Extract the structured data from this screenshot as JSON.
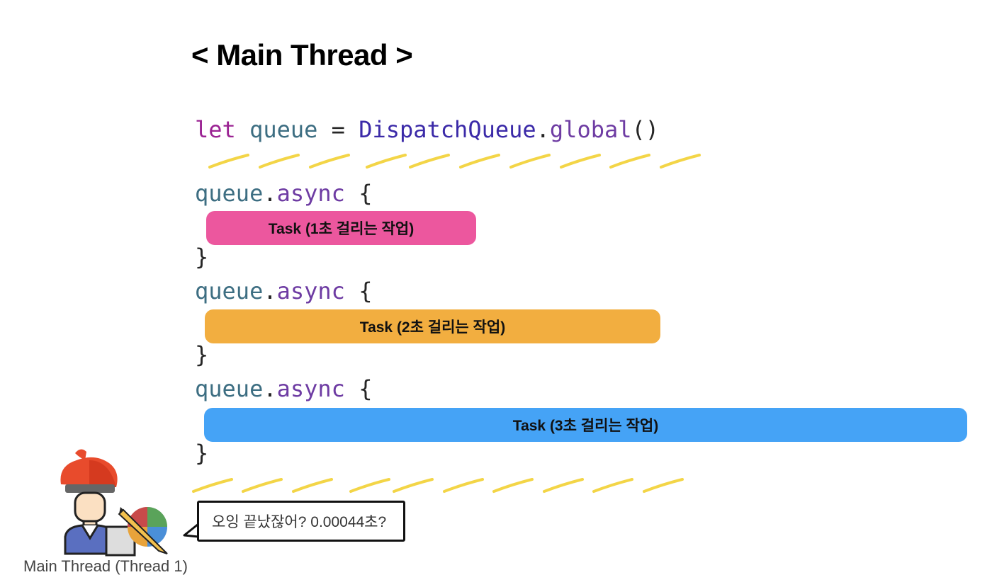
{
  "title": "< Main Thread >",
  "code": {
    "line1": {
      "kw": "let",
      "var": "queue",
      "eq": "=",
      "type": "DispatchQueue",
      "dot": ".",
      "method": "global",
      "paren": "()"
    },
    "async_block": {
      "var": "queue",
      "dot": ".",
      "method": "async",
      "open": "{",
      "close": "}"
    }
  },
  "tasks": [
    {
      "label": "Task (1초 걸리는 작업)",
      "color": "#ec579e"
    },
    {
      "label": "Task (2초 걸리는 작업)",
      "color": "#f2ae40"
    },
    {
      "label": "Task (3초 걸리는 작업)",
      "color": "#45a3f6"
    }
  ],
  "speech": "오잉 끝났잖어? 0.00044초?",
  "caption": "Main Thread (Thread 1)",
  "colors": {
    "dash": "#f3d547",
    "avatar_hat": "#e84b2c"
  }
}
